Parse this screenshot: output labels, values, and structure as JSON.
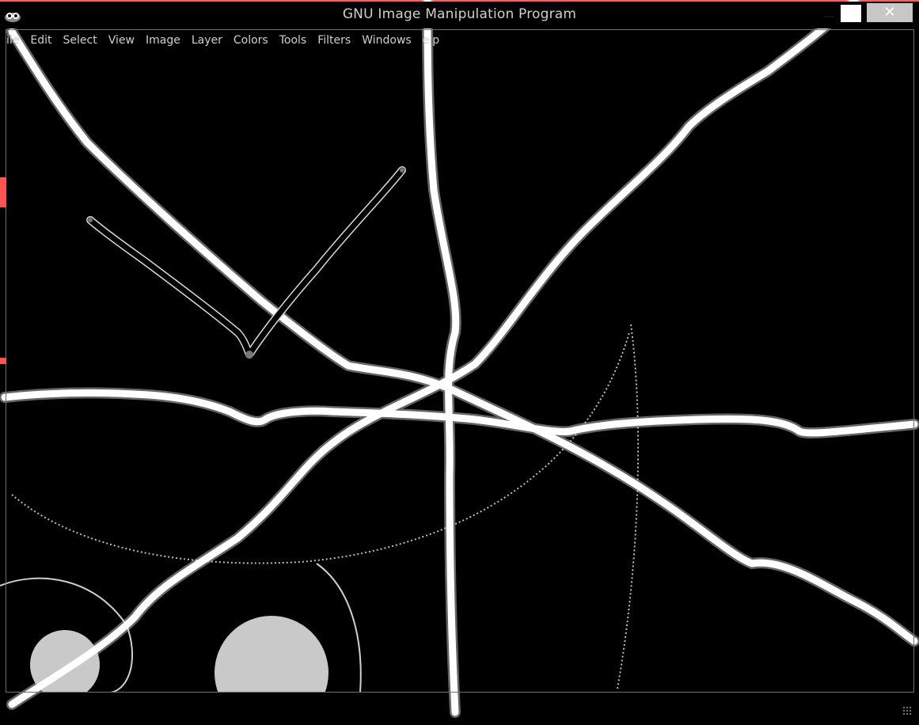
{
  "window": {
    "title": "GNU Image Manipulation Program",
    "close_glyph": "✕",
    "app_icon": "gimp-wilber-icon"
  },
  "menubar": {
    "items": [
      {
        "id": "file",
        "label": "ile"
      },
      {
        "id": "edit",
        "label": "Edit"
      },
      {
        "id": "select",
        "label": "Select"
      },
      {
        "id": "view",
        "label": "View"
      },
      {
        "id": "image",
        "label": "Image"
      },
      {
        "id": "layer",
        "label": "Layer"
      },
      {
        "id": "colors",
        "label": "Colors"
      },
      {
        "id": "tools",
        "label": "Tools"
      },
      {
        "id": "filters",
        "label": "Filters"
      },
      {
        "id": "windows",
        "label": "Windows"
      },
      {
        "id": "help",
        "label": "elp"
      }
    ]
  },
  "colors": {
    "background": "#000000",
    "stroke": "#ffffff",
    "shadow": "#c9c9c9",
    "accent": "#ff5252",
    "ui_text": "#cfcfcf"
  }
}
